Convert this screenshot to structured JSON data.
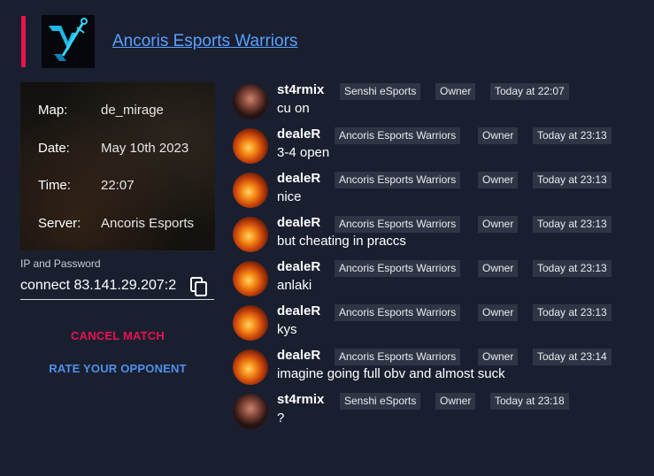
{
  "header": {
    "team_name": "Ancoris Esports Warriors",
    "logo_icon": "sword-logo-icon",
    "accent_color": "#e8134f"
  },
  "match": {
    "map_label": "Map:",
    "map_value": "de_mirage",
    "date_label": "Date:",
    "date_value": "May 10th 2023",
    "time_label": "Time:",
    "time_value": "22:07",
    "server_label": "Server:",
    "server_value": "Ancoris Esports"
  },
  "connection": {
    "label": "IP and Password",
    "value": "connect 83.141.29.207:2",
    "copy_icon": "copy-icon"
  },
  "actions": {
    "cancel_label": "CANCEL MATCH",
    "rate_label": "RATE YOUR OPPONENT"
  },
  "messages": [
    {
      "author": "st4rmix",
      "team": "Senshi eSports",
      "role": "Owner",
      "time": "Today at 22:07",
      "text": "cu on"
    },
    {
      "author": "dealeR",
      "team": "Ancoris Esports Warriors",
      "role": "Owner",
      "time": "Today at 23:13",
      "text": "3-4 open"
    },
    {
      "author": "dealeR",
      "team": "Ancoris Esports Warriors",
      "role": "Owner",
      "time": "Today at 23:13",
      "text": "nice"
    },
    {
      "author": "dealeR",
      "team": "Ancoris Esports Warriors",
      "role": "Owner",
      "time": "Today at 23:13",
      "text": "but cheating in praccs"
    },
    {
      "author": "dealeR",
      "team": "Ancoris Esports Warriors",
      "role": "Owner",
      "time": "Today at 23:13",
      "text": "anlaki"
    },
    {
      "author": "dealeR",
      "team": "Ancoris Esports Warriors",
      "role": "Owner",
      "time": "Today at 23:13",
      "text": "kys"
    },
    {
      "author": "dealeR",
      "team": "Ancoris Esports Warriors",
      "role": "Owner",
      "time": "Today at 23:14",
      "text": "imagine going full obv and almost suck"
    },
    {
      "author": "st4rmix",
      "team": "Senshi eSports",
      "role": "Owner",
      "time": "Today at 23:18",
      "text": "?"
    }
  ]
}
